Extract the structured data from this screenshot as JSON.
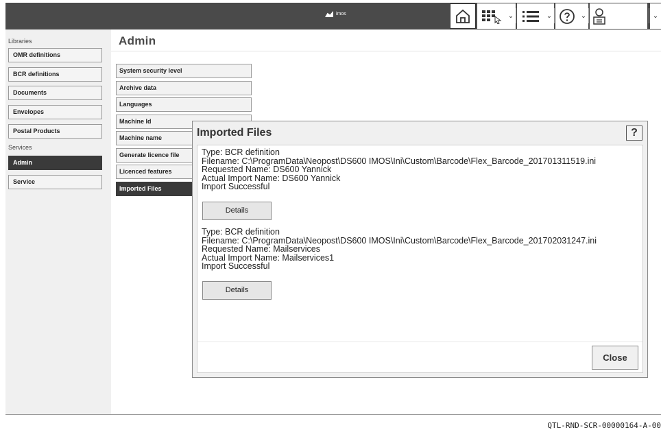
{
  "app": {
    "brand": "imos"
  },
  "sidebar": {
    "libraries_heading": "Libraries",
    "services_heading": "Services",
    "library_items": [
      {
        "label": "OMR definitions"
      },
      {
        "label": "BCR definitions"
      },
      {
        "label": "Documents"
      },
      {
        "label": "Envelopes"
      },
      {
        "label": "Postal Products"
      }
    ],
    "service_items": [
      {
        "label": "Admin",
        "active": true
      },
      {
        "label": "Service"
      }
    ]
  },
  "main": {
    "title": "Admin",
    "admin_items": [
      {
        "label": "System security level"
      },
      {
        "label": "Archive data"
      },
      {
        "label": "Languages"
      },
      {
        "label": "Machine Id"
      },
      {
        "label": "Machine name"
      },
      {
        "label": "Generate licence file"
      },
      {
        "label": "Licenced features"
      },
      {
        "label": "Imported Files",
        "active": true
      }
    ]
  },
  "dialog": {
    "title": "Imported Files",
    "help_label": "?",
    "entries": [
      {
        "type": "Type: BCR definition",
        "filename": "Filename: C:\\ProgramData\\Neopost\\DS600 IMOS\\Ini\\Custom\\Barcode\\Flex_Barcode_201701311519.ini",
        "requested": "Requested Name: DS600 Yannick",
        "actual": "Actual Import Name: DS600 Yannick",
        "status": "Import Successful",
        "details_label": "Details"
      },
      {
        "type": "Type: BCR definition",
        "filename": "Filename: C:\\ProgramData\\Neopost\\DS600 IMOS\\Ini\\Custom\\Barcode\\Flex_Barcode_201702031247.ini",
        "requested": "Requested Name: Mailservices",
        "actual": "Actual Import Name: Mailservices1",
        "status": "Import Successful",
        "details_label": "Details"
      }
    ],
    "close_label": "Close"
  },
  "doc_id": "QTL-RND-SCR-00000164-A-00"
}
